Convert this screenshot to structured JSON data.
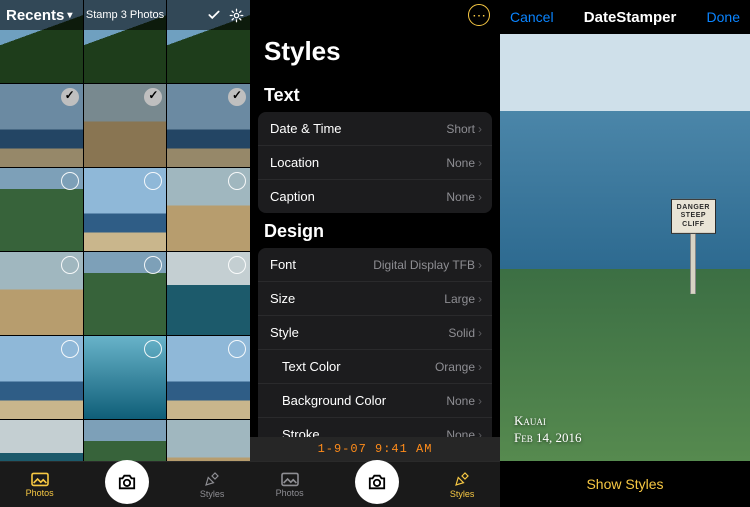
{
  "phone1": {
    "album": "Recents",
    "header_action": "Stamp 3 Photos",
    "tabs": {
      "photos": "Photos",
      "styles": "Styles"
    }
  },
  "phone2": {
    "title": "Styles",
    "sections": {
      "text": {
        "header": "Text",
        "date_time": {
          "label": "Date & Time",
          "value": "Short"
        },
        "location": {
          "label": "Location",
          "value": "None"
        },
        "caption": {
          "label": "Caption",
          "value": "None"
        }
      },
      "design": {
        "header": "Design",
        "font": {
          "label": "Font",
          "value": "Digital Display TFB"
        },
        "size": {
          "label": "Size",
          "value": "Large"
        },
        "style": {
          "label": "Style",
          "value": "Solid"
        },
        "text_color": {
          "label": "Text Color",
          "value": "Orange"
        },
        "background_color": {
          "label": "Background Color",
          "value": "None"
        },
        "stroke": {
          "label": "Stroke",
          "value": "None"
        }
      }
    },
    "preview_stamp": "1-9-07 9:41 AM",
    "tabs": {
      "photos": "Photos",
      "styles": "Styles"
    }
  },
  "phone3": {
    "cancel": "Cancel",
    "done": "Done",
    "title": "DateStamper",
    "sign": {
      "l1": "DANGER",
      "l2": "STEEP",
      "l3": "CLIFF"
    },
    "stamp": {
      "location": "Kauai",
      "date": "Feb 14, 2016"
    },
    "footer": "Show Styles"
  }
}
